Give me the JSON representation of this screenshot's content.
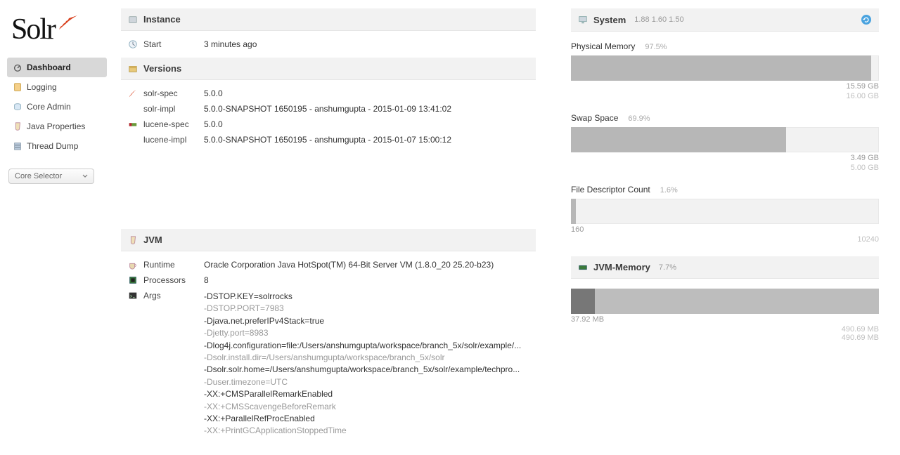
{
  "logo_text": "Solr",
  "nav": {
    "items": [
      {
        "label": "Dashboard",
        "active": true
      },
      {
        "label": "Logging",
        "active": false
      },
      {
        "label": "Core Admin",
        "active": false
      },
      {
        "label": "Java Properties",
        "active": false
      },
      {
        "label": "Thread Dump",
        "active": false
      }
    ],
    "selector_label": "Core Selector"
  },
  "instance": {
    "title": "Instance",
    "start_label": "Start",
    "start_value": "3 minutes ago"
  },
  "versions": {
    "title": "Versions",
    "rows": [
      {
        "label": "solr-spec",
        "value": "5.0.0"
      },
      {
        "label": "solr-impl",
        "value": "5.0.0-SNAPSHOT 1650195 - anshumgupta - 2015-01-09 13:41:02"
      },
      {
        "label": "lucene-spec",
        "value": "5.0.0"
      },
      {
        "label": "lucene-impl",
        "value": "5.0.0-SNAPSHOT 1650195 - anshumgupta - 2015-01-07 15:00:12"
      }
    ]
  },
  "jvm": {
    "title": "JVM",
    "runtime_label": "Runtime",
    "runtime_value": "Oracle Corporation Java HotSpot(TM) 64-Bit Server VM (1.8.0_20 25.20-b23)",
    "processors_label": "Processors",
    "processors_value": "8",
    "args_label": "Args",
    "args": [
      "-DSTOP.KEY=solrrocks",
      "-DSTOP.PORT=7983",
      "-Djava.net.preferIPv4Stack=true",
      "-Djetty.port=8983",
      "-Dlog4j.configuration=file:/Users/anshumgupta/workspace/branch_5x/solr/example/...",
      "-Dsolr.install.dir=/Users/anshumgupta/workspace/branch_5x/solr",
      "-Dsolr.solr.home=/Users/anshumgupta/workspace/branch_5x/solr/example/techpro...",
      "-Duser.timezone=UTC",
      "-XX:+CMSParallelRemarkEnabled",
      "-XX:+CMSScavengeBeforeRemark",
      "-XX:+ParallelRefProcEnabled",
      "-XX:+PrintGCApplicationStoppedTime"
    ]
  },
  "system": {
    "title": "System",
    "load": "1.88  1.60  1.50",
    "physmem": {
      "label": "Physical Memory",
      "pct": "97.5%",
      "used": "15.59 GB",
      "total": "16.00 GB",
      "bar_pct": 97.5
    },
    "swap": {
      "label": "Swap Space",
      "pct": "69.9%",
      "used": "3.49 GB",
      "total": "5.00 GB",
      "bar_pct": 69.9
    },
    "fd": {
      "label": "File Descriptor Count",
      "pct": "1.6%",
      "used": "160",
      "total": "10240",
      "bar_pct": 1.6
    }
  },
  "jvmmem": {
    "title": "JVM-Memory",
    "pct": "7.7%",
    "used": "37.92 MB",
    "inner_pct": 7.7,
    "current": "490.69 MB",
    "total": "490.69 MB"
  }
}
